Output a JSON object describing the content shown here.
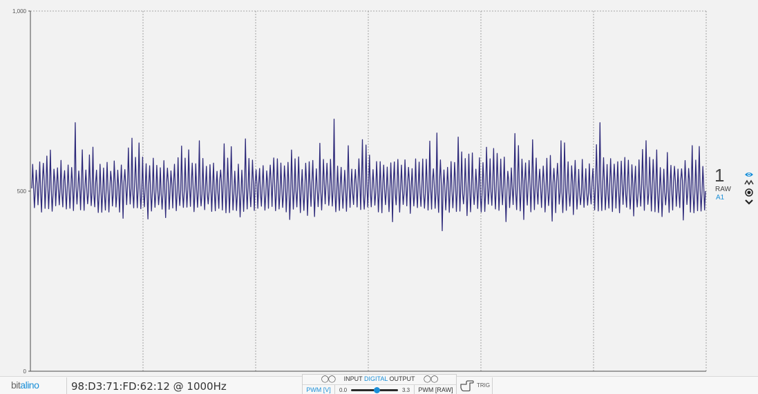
{
  "chart_data": {
    "type": "line",
    "title": "",
    "xlabel": "",
    "ylabel": "",
    "ylim": [
      0,
      1000
    ],
    "yticks": [
      "0",
      "500",
      "1,000"
    ],
    "grid": true,
    "series": [
      {
        "color": "#2e2a7a",
        "sample_rate_hz": 1000,
        "baseline": 510,
        "typical_min": 450,
        "typical_max": 575,
        "peak_max": 700,
        "trough_min": 390
      }
    ]
  },
  "channel": {
    "number": "1",
    "mode": "RAW",
    "name": "A1",
    "icons": [
      "eye-icon",
      "signal-icon",
      "record-icon",
      "chevron-down-icon"
    ]
  },
  "footer": {
    "logo_main": "bit",
    "logo_accent": "alino",
    "device": "98:D3:71:FD:62:12 @ 1000Hz",
    "io": {
      "input_label": "INPUT",
      "digital_label": "DIGITAL",
      "output_label": "OUTPUT",
      "input_circles": "◯◯",
      "output_circles": "◯◯",
      "pwm_v_label": "PWM [V]",
      "pwm_min": "0.0",
      "pwm_max": "3.3",
      "pwm_value": 0.55,
      "pwm_raw_label": "PWM [RAW]"
    },
    "trig_label": "TRIG"
  },
  "colors": {
    "accent": "#1a8fd8",
    "signal": "#2e2a7a",
    "background": "#f2f2f2"
  }
}
